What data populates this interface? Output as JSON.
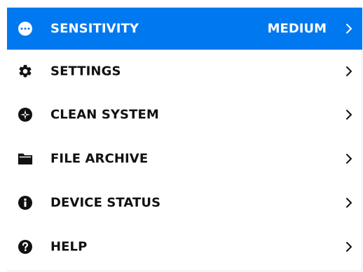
{
  "menu": {
    "items": [
      {
        "label": "SENSITIVITY",
        "value": "MEDIUM",
        "icon": "dots-circle-icon",
        "selected": true
      },
      {
        "label": "SETTINGS",
        "icon": "gear-icon"
      },
      {
        "label": "CLEAN SYSTEM",
        "icon": "clean-icon"
      },
      {
        "label": "FILE ARCHIVE",
        "icon": "folder-icon"
      },
      {
        "label": "DEVICE STATUS",
        "icon": "info-icon"
      },
      {
        "label": "HELP",
        "icon": "help-icon"
      }
    ]
  },
  "colors": {
    "selected_background": "#0078f0",
    "selected_text": "#ffffff",
    "text": "#111111"
  }
}
